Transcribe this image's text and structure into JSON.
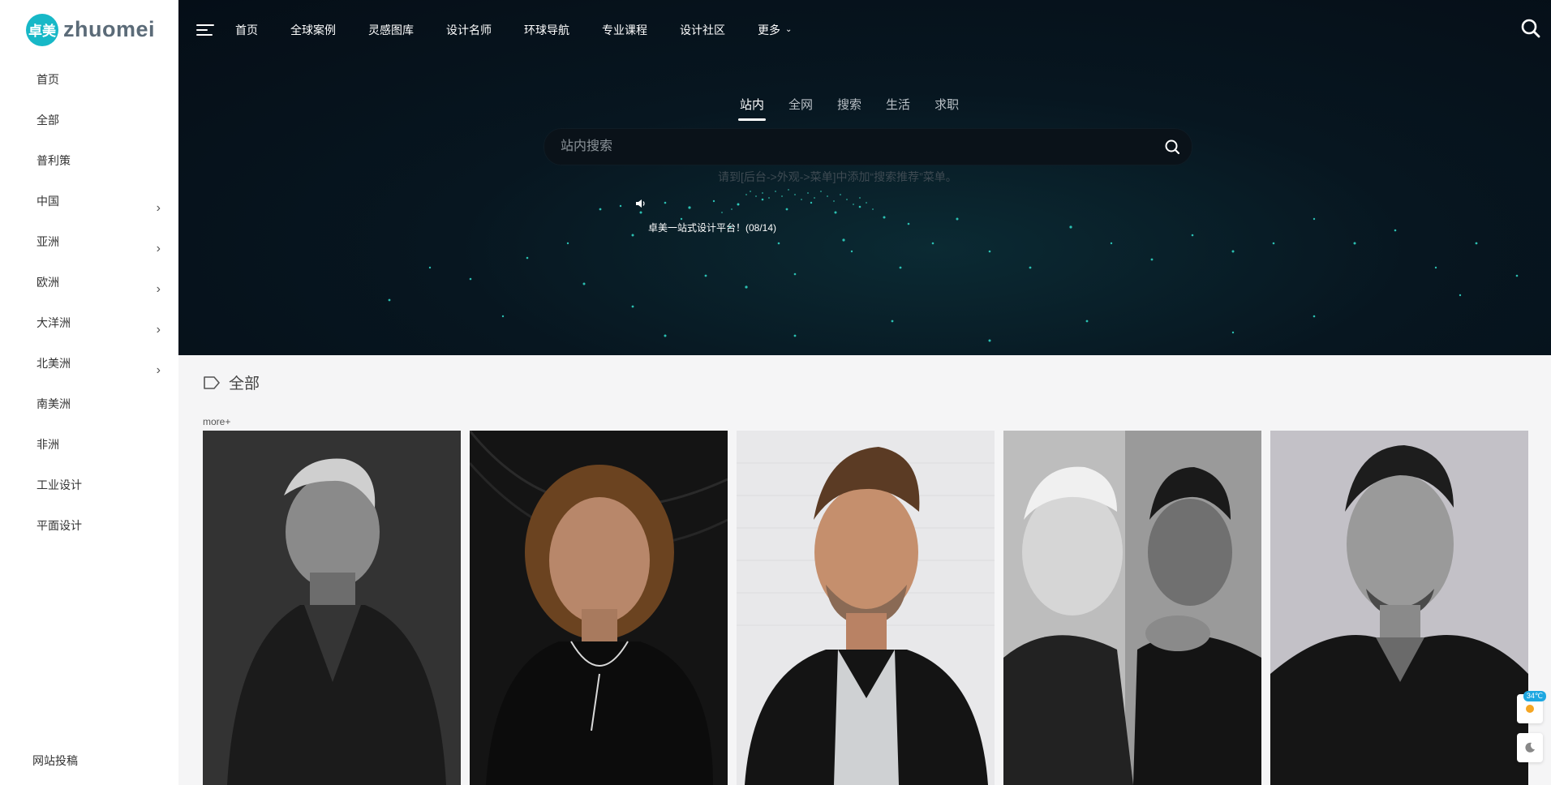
{
  "logo": {
    "mark": "卓美",
    "text": "zhuomei"
  },
  "sidebar": {
    "items": [
      {
        "label": "首页",
        "has_sub": false
      },
      {
        "label": "全部",
        "has_sub": false
      },
      {
        "label": "普利策",
        "has_sub": false
      },
      {
        "label": "中国",
        "has_sub": true
      },
      {
        "label": "亚洲",
        "has_sub": true
      },
      {
        "label": "欧洲",
        "has_sub": true
      },
      {
        "label": "大洋洲",
        "has_sub": true
      },
      {
        "label": "北美洲",
        "has_sub": true
      },
      {
        "label": "南美洲",
        "has_sub": false
      },
      {
        "label": "非洲",
        "has_sub": false
      },
      {
        "label": "工业设计",
        "has_sub": false
      },
      {
        "label": "平面设计",
        "has_sub": false
      }
    ],
    "bottom_link": "网站投稿"
  },
  "topnav": {
    "items": [
      "首页",
      "全球案例",
      "灵感图库",
      "设计名师",
      "环球导航",
      "专业课程",
      "设计社区",
      "更多"
    ],
    "icon_menu": "menu-icon",
    "icon_search": "search-icon"
  },
  "search": {
    "tabs": [
      "站内",
      "全网",
      "搜索",
      "生活",
      "求职"
    ],
    "active_tab": "站内",
    "placeholder": "站内搜索",
    "hint": "请到[后台->外观->菜单]中添加“搜索推荐”菜单。",
    "ticker": "卓美一站式设计平台！(08/14)"
  },
  "section": {
    "title": "全部",
    "more": "more+"
  },
  "cards": [
    {
      "name": "portrait-1",
      "tone": "bw"
    },
    {
      "name": "portrait-2",
      "tone": "color"
    },
    {
      "name": "portrait-3",
      "tone": "color"
    },
    {
      "name": "portrait-4",
      "tone": "bw"
    },
    {
      "name": "portrait-5",
      "tone": "bw"
    }
  ],
  "widgets": {
    "temperature": "34℃",
    "theme_icon": "moon-icon",
    "weather_icon": "sun-icon"
  },
  "colors": {
    "brand": "#17b8c7",
    "hero_bg": "#071620",
    "accent_temp": "#1ea7e1"
  }
}
